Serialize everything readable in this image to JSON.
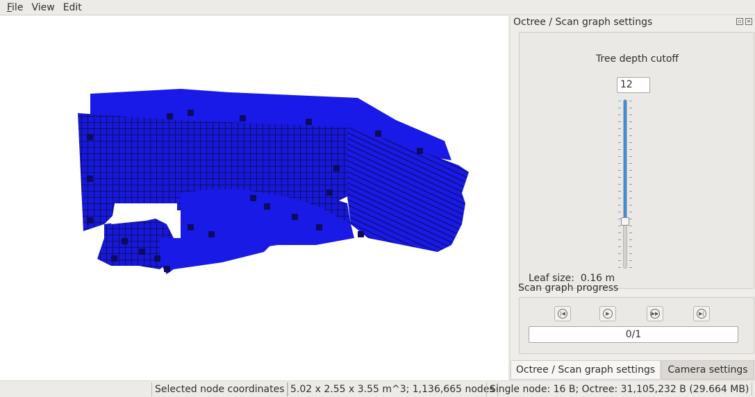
{
  "menubar": {
    "items": [
      {
        "label_accel": "F",
        "label_rest": "ile"
      },
      {
        "label_accel": "",
        "label_rest": "View"
      },
      {
        "label_accel": "",
        "label_rest": "Edit"
      }
    ]
  },
  "dock": {
    "title": "Octree / Scan graph settings",
    "depth": {
      "label": "Tree depth cutoff",
      "value": "12",
      "slider_fraction": 0.72,
      "leaf_size_label": "Leaf size:",
      "leaf_size_value": "0.16 m"
    },
    "scan": {
      "title": "Scan graph progress",
      "buttons": [
        {
          "icon": "skip-back-icon",
          "glyph": "|◀"
        },
        {
          "icon": "play-icon",
          "glyph": "▶"
        },
        {
          "icon": "fast-forward-icon",
          "glyph": "▶▶"
        },
        {
          "icon": "skip-forward-icon",
          "glyph": "▶|"
        }
      ],
      "progress_text": "0/1"
    },
    "tabs": [
      {
        "label": "Octree / Scan graph settings",
        "active": true
      },
      {
        "label": "Camera settings",
        "active": false
      }
    ]
  },
  "statusbar": {
    "selected": "Selected node coordinates",
    "stats": "5.02 x 2.55 x 3.55 m^3; 1,136,665 nodes",
    "memory": "Single node: 16 B; Octree: 31,105,232 B (29.664 MB)"
  },
  "colors": {
    "voxel": "#1a1ae6",
    "voxel_dark": "#0b0b5a",
    "slider_fill": "#3c8fd6"
  }
}
